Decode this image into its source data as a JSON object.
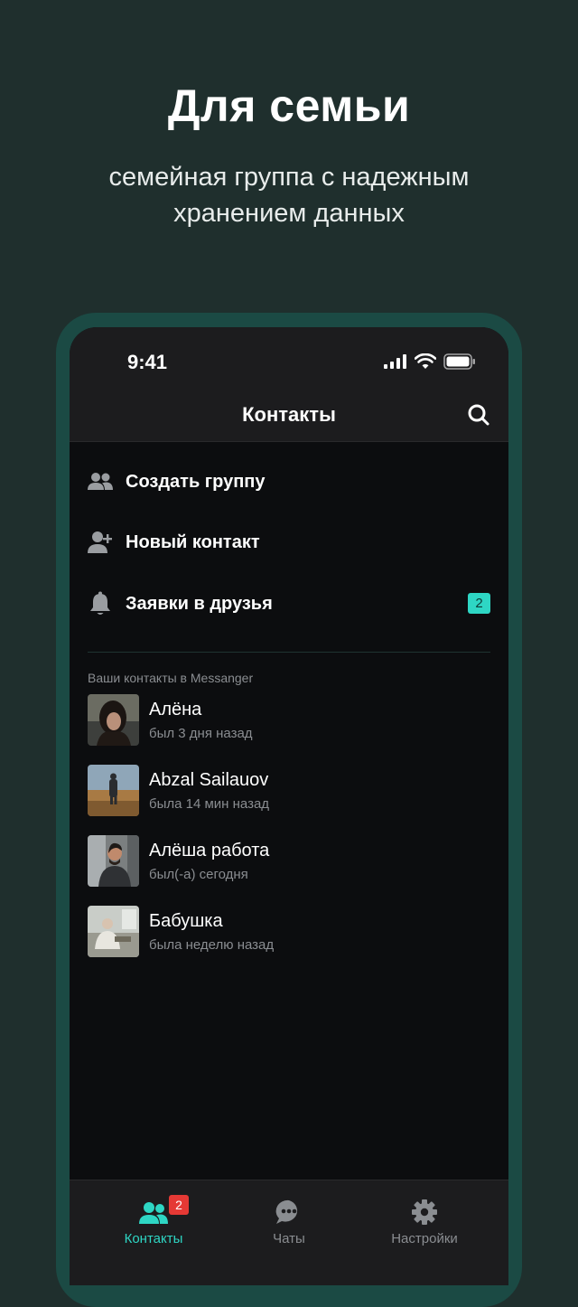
{
  "promo": {
    "title": "Для семьи",
    "subtitle": "семейная группа с надежным хранением данных"
  },
  "status_bar": {
    "time": "9:41"
  },
  "nav": {
    "title": "Контакты"
  },
  "menu": [
    {
      "label": "Создать группу",
      "icon": "group-icon"
    },
    {
      "label": "Новый контакт",
      "icon": "add-contact-icon"
    },
    {
      "label": "Заявки в друзья",
      "icon": "bell-icon",
      "badge": "2"
    }
  ],
  "section_label": "Ваши контакты в Messanger",
  "contacts": [
    {
      "name": "Алёна",
      "status": "был 3 дня назад"
    },
    {
      "name": "Abzal Sailauov",
      "status": "была 14 мин назад"
    },
    {
      "name": "Алёша работа",
      "status": "был(-а) сегодня"
    },
    {
      "name": "Бабушка",
      "status": "была неделю назад"
    }
  ],
  "tabs": [
    {
      "label": "Контакты",
      "icon": "contacts-icon",
      "badge": "2",
      "active": true
    },
    {
      "label": "Чаты",
      "icon": "chat-icon"
    },
    {
      "label": "Настройки",
      "icon": "gear-icon"
    }
  ],
  "colors": {
    "accent": "#2ed6c4",
    "badge_red": "#e53935",
    "background": "#1f2f2d"
  }
}
